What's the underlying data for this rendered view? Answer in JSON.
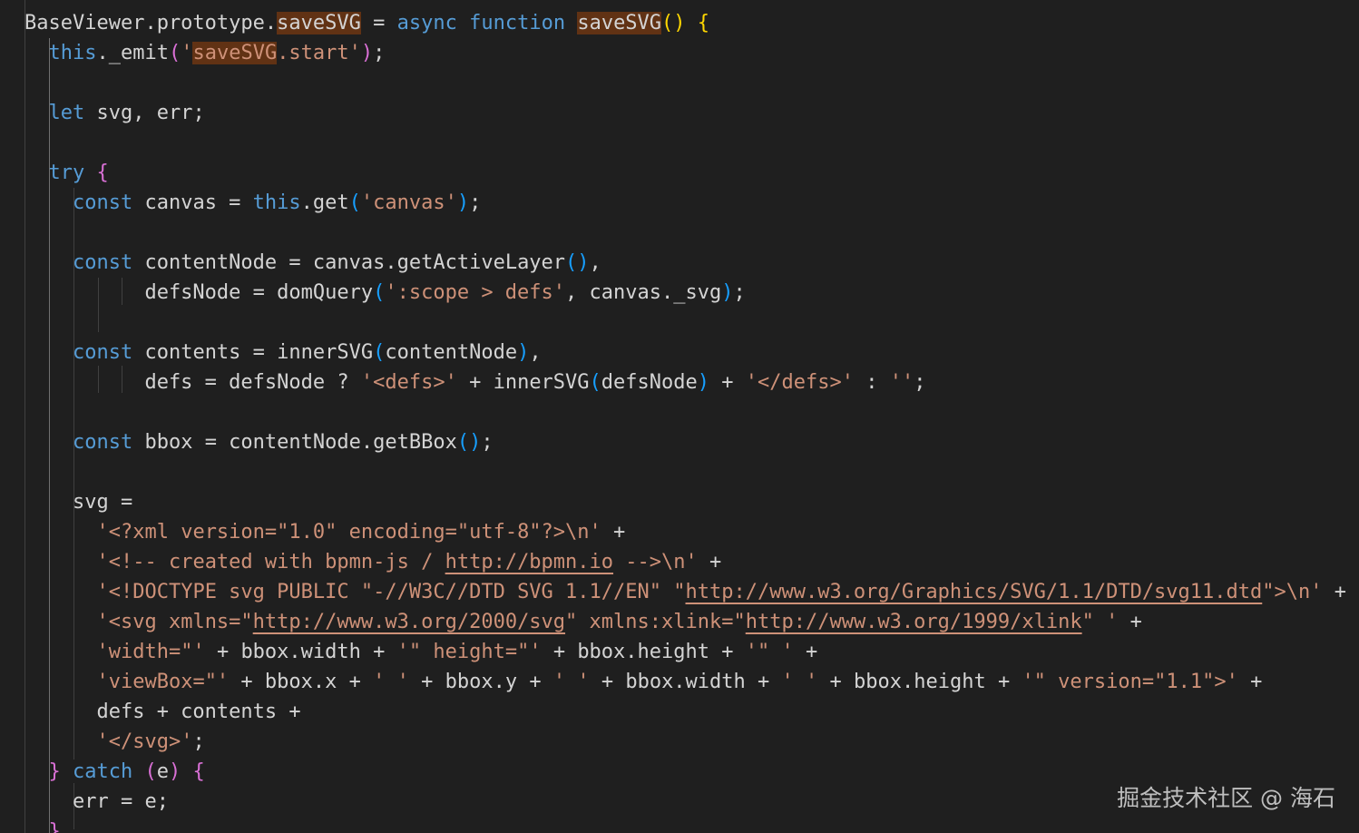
{
  "editor": {
    "lines": [
      [
        {
          "t": "BaseViewer.prototype.",
          "c": "plain"
        },
        {
          "t": "saveSVG",
          "c": "plain",
          "hl": true
        },
        {
          "t": " = ",
          "c": "plain"
        },
        {
          "t": "async",
          "c": "kw"
        },
        {
          "t": " ",
          "c": "plain"
        },
        {
          "t": "function",
          "c": "kw"
        },
        {
          "t": " ",
          "c": "plain"
        },
        {
          "t": "saveSVG",
          "c": "plain",
          "hl": true
        },
        {
          "t": "()",
          "c": "brace-gold"
        },
        {
          "t": " ",
          "c": "plain"
        },
        {
          "t": "{",
          "c": "brace-gold"
        }
      ],
      [
        {
          "t": "  ",
          "c": "plain"
        },
        {
          "t": "this",
          "c": "kw"
        },
        {
          "t": "._emit",
          "c": "plain"
        },
        {
          "t": "(",
          "c": "brace-purple"
        },
        {
          "t": "'",
          "c": "str"
        },
        {
          "t": "saveSVG",
          "c": "str",
          "hl": true
        },
        {
          "t": ".start'",
          "c": "str"
        },
        {
          "t": ")",
          "c": "brace-purple"
        },
        {
          "t": ";",
          "c": "plain"
        }
      ],
      [],
      [
        {
          "t": "  ",
          "c": "plain"
        },
        {
          "t": "let",
          "c": "kw"
        },
        {
          "t": " svg, err;",
          "c": "plain"
        }
      ],
      [],
      [
        {
          "t": "  ",
          "c": "plain"
        },
        {
          "t": "try",
          "c": "kw"
        },
        {
          "t": " ",
          "c": "plain"
        },
        {
          "t": "{",
          "c": "brace-purple"
        }
      ],
      [
        {
          "t": "    ",
          "c": "plain"
        },
        {
          "t": "const",
          "c": "kw"
        },
        {
          "t": " canvas = ",
          "c": "plain"
        },
        {
          "t": "this",
          "c": "kw"
        },
        {
          "t": ".get",
          "c": "plain"
        },
        {
          "t": "(",
          "c": "brace-blue"
        },
        {
          "t": "'canvas'",
          "c": "str"
        },
        {
          "t": ")",
          "c": "brace-blue"
        },
        {
          "t": ";",
          "c": "plain"
        }
      ],
      [],
      [
        {
          "t": "    ",
          "c": "plain"
        },
        {
          "t": "const",
          "c": "kw"
        },
        {
          "t": " contentNode = canvas.getActiveLayer",
          "c": "plain"
        },
        {
          "t": "()",
          "c": "brace-blue"
        },
        {
          "t": ",",
          "c": "plain"
        }
      ],
      [
        {
          "t": "          defsNode = domQuery",
          "c": "plain"
        },
        {
          "t": "(",
          "c": "brace-blue"
        },
        {
          "t": "':scope > defs'",
          "c": "str"
        },
        {
          "t": ", canvas._svg",
          "c": "plain"
        },
        {
          "t": ")",
          "c": "brace-blue"
        },
        {
          "t": ";",
          "c": "plain"
        }
      ],
      [],
      [
        {
          "t": "    ",
          "c": "plain"
        },
        {
          "t": "const",
          "c": "kw"
        },
        {
          "t": " contents = innerSVG",
          "c": "plain"
        },
        {
          "t": "(",
          "c": "brace-blue"
        },
        {
          "t": "contentNode",
          "c": "plain"
        },
        {
          "t": ")",
          "c": "brace-blue"
        },
        {
          "t": ",",
          "c": "plain"
        }
      ],
      [
        {
          "t": "          defs = defsNode ? ",
          "c": "plain"
        },
        {
          "t": "'<defs>'",
          "c": "str"
        },
        {
          "t": " + innerSVG",
          "c": "plain"
        },
        {
          "t": "(",
          "c": "brace-blue"
        },
        {
          "t": "defsNode",
          "c": "plain"
        },
        {
          "t": ")",
          "c": "brace-blue"
        },
        {
          "t": " + ",
          "c": "plain"
        },
        {
          "t": "'</defs>'",
          "c": "str"
        },
        {
          "t": " : ",
          "c": "plain"
        },
        {
          "t": "''",
          "c": "str"
        },
        {
          "t": ";",
          "c": "plain"
        }
      ],
      [],
      [
        {
          "t": "    ",
          "c": "plain"
        },
        {
          "t": "const",
          "c": "kw"
        },
        {
          "t": " bbox = contentNode.getBBox",
          "c": "plain"
        },
        {
          "t": "()",
          "c": "brace-blue"
        },
        {
          "t": ";",
          "c": "plain"
        }
      ],
      [],
      [
        {
          "t": "    svg =",
          "c": "plain"
        }
      ],
      [
        {
          "t": "      ",
          "c": "plain"
        },
        {
          "t": "'<?xml version=\"1.0\" encoding=\"utf-8\"?>\\n'",
          "c": "str"
        },
        {
          "t": " +",
          "c": "plain"
        }
      ],
      [
        {
          "t": "      ",
          "c": "plain"
        },
        {
          "t": "'<!-- created with bpmn-js / ",
          "c": "str"
        },
        {
          "t": "http://bpmn.io",
          "c": "str",
          "link": true
        },
        {
          "t": " -->\\n'",
          "c": "str"
        },
        {
          "t": " +",
          "c": "plain"
        }
      ],
      [
        {
          "t": "      ",
          "c": "plain"
        },
        {
          "t": "'<!DOCTYPE svg PUBLIC \"-//W3C//DTD SVG 1.1//EN\" \"",
          "c": "str"
        },
        {
          "t": "http://www.w3.org/Graphics/SVG/1.1/DTD/svg11.dtd",
          "c": "str",
          "link": true
        },
        {
          "t": "\">\\n'",
          "c": "str"
        },
        {
          "t": " +",
          "c": "plain"
        }
      ],
      [
        {
          "t": "      ",
          "c": "plain"
        },
        {
          "t": "'<svg xmlns=\"",
          "c": "str"
        },
        {
          "t": "http://www.w3.org/2000/svg",
          "c": "str",
          "link": true
        },
        {
          "t": "\" xmlns:xlink=\"",
          "c": "str"
        },
        {
          "t": "http://www.w3.org/1999/xlink",
          "c": "str",
          "link": true
        },
        {
          "t": "\" '",
          "c": "str"
        },
        {
          "t": " +",
          "c": "plain"
        }
      ],
      [
        {
          "t": "      ",
          "c": "plain"
        },
        {
          "t": "'width=\"'",
          "c": "str"
        },
        {
          "t": " + bbox.width + ",
          "c": "plain"
        },
        {
          "t": "'\" height=\"'",
          "c": "str"
        },
        {
          "t": " + bbox.height + ",
          "c": "plain"
        },
        {
          "t": "'\" '",
          "c": "str"
        },
        {
          "t": " +",
          "c": "plain"
        }
      ],
      [
        {
          "t": "      ",
          "c": "plain"
        },
        {
          "t": "'viewBox=\"'",
          "c": "str"
        },
        {
          "t": " + bbox.x + ",
          "c": "plain"
        },
        {
          "t": "' '",
          "c": "str"
        },
        {
          "t": " + bbox.y + ",
          "c": "plain"
        },
        {
          "t": "' '",
          "c": "str"
        },
        {
          "t": " + bbox.width + ",
          "c": "plain"
        },
        {
          "t": "' '",
          "c": "str"
        },
        {
          "t": " + bbox.height + ",
          "c": "plain"
        },
        {
          "t": "'\" version=\"1.1\">'",
          "c": "str"
        },
        {
          "t": " +",
          "c": "plain"
        }
      ],
      [
        {
          "t": "      defs + contents +",
          "c": "plain"
        }
      ],
      [
        {
          "t": "      ",
          "c": "plain"
        },
        {
          "t": "'</svg>'",
          "c": "str"
        },
        {
          "t": ";",
          "c": "plain"
        }
      ],
      [
        {
          "t": "  ",
          "c": "plain"
        },
        {
          "t": "}",
          "c": "brace-purple"
        },
        {
          "t": " ",
          "c": "plain"
        },
        {
          "t": "catch",
          "c": "kw"
        },
        {
          "t": " ",
          "c": "plain"
        },
        {
          "t": "(",
          "c": "brace-purple"
        },
        {
          "t": "e",
          "c": "plain"
        },
        {
          "t": ")",
          "c": "brace-purple"
        },
        {
          "t": " ",
          "c": "plain"
        },
        {
          "t": "{",
          "c": "brace-purple"
        }
      ],
      [
        {
          "t": "    err = e;",
          "c": "plain"
        }
      ],
      [
        {
          "t": "  ",
          "c": "plain"
        },
        {
          "t": "}",
          "c": "brace-purple"
        }
      ]
    ]
  },
  "colors": {
    "background": "#1f1f1f",
    "keyword": "#569cd6",
    "string": "#ce9178",
    "plain": "#d4d4d4",
    "highlight": "#613214",
    "bracket_gold": "#ffd700",
    "bracket_purple": "#da70d6",
    "bracket_blue": "#179fff"
  },
  "watermark": "掘金技术社区 @ 海石"
}
